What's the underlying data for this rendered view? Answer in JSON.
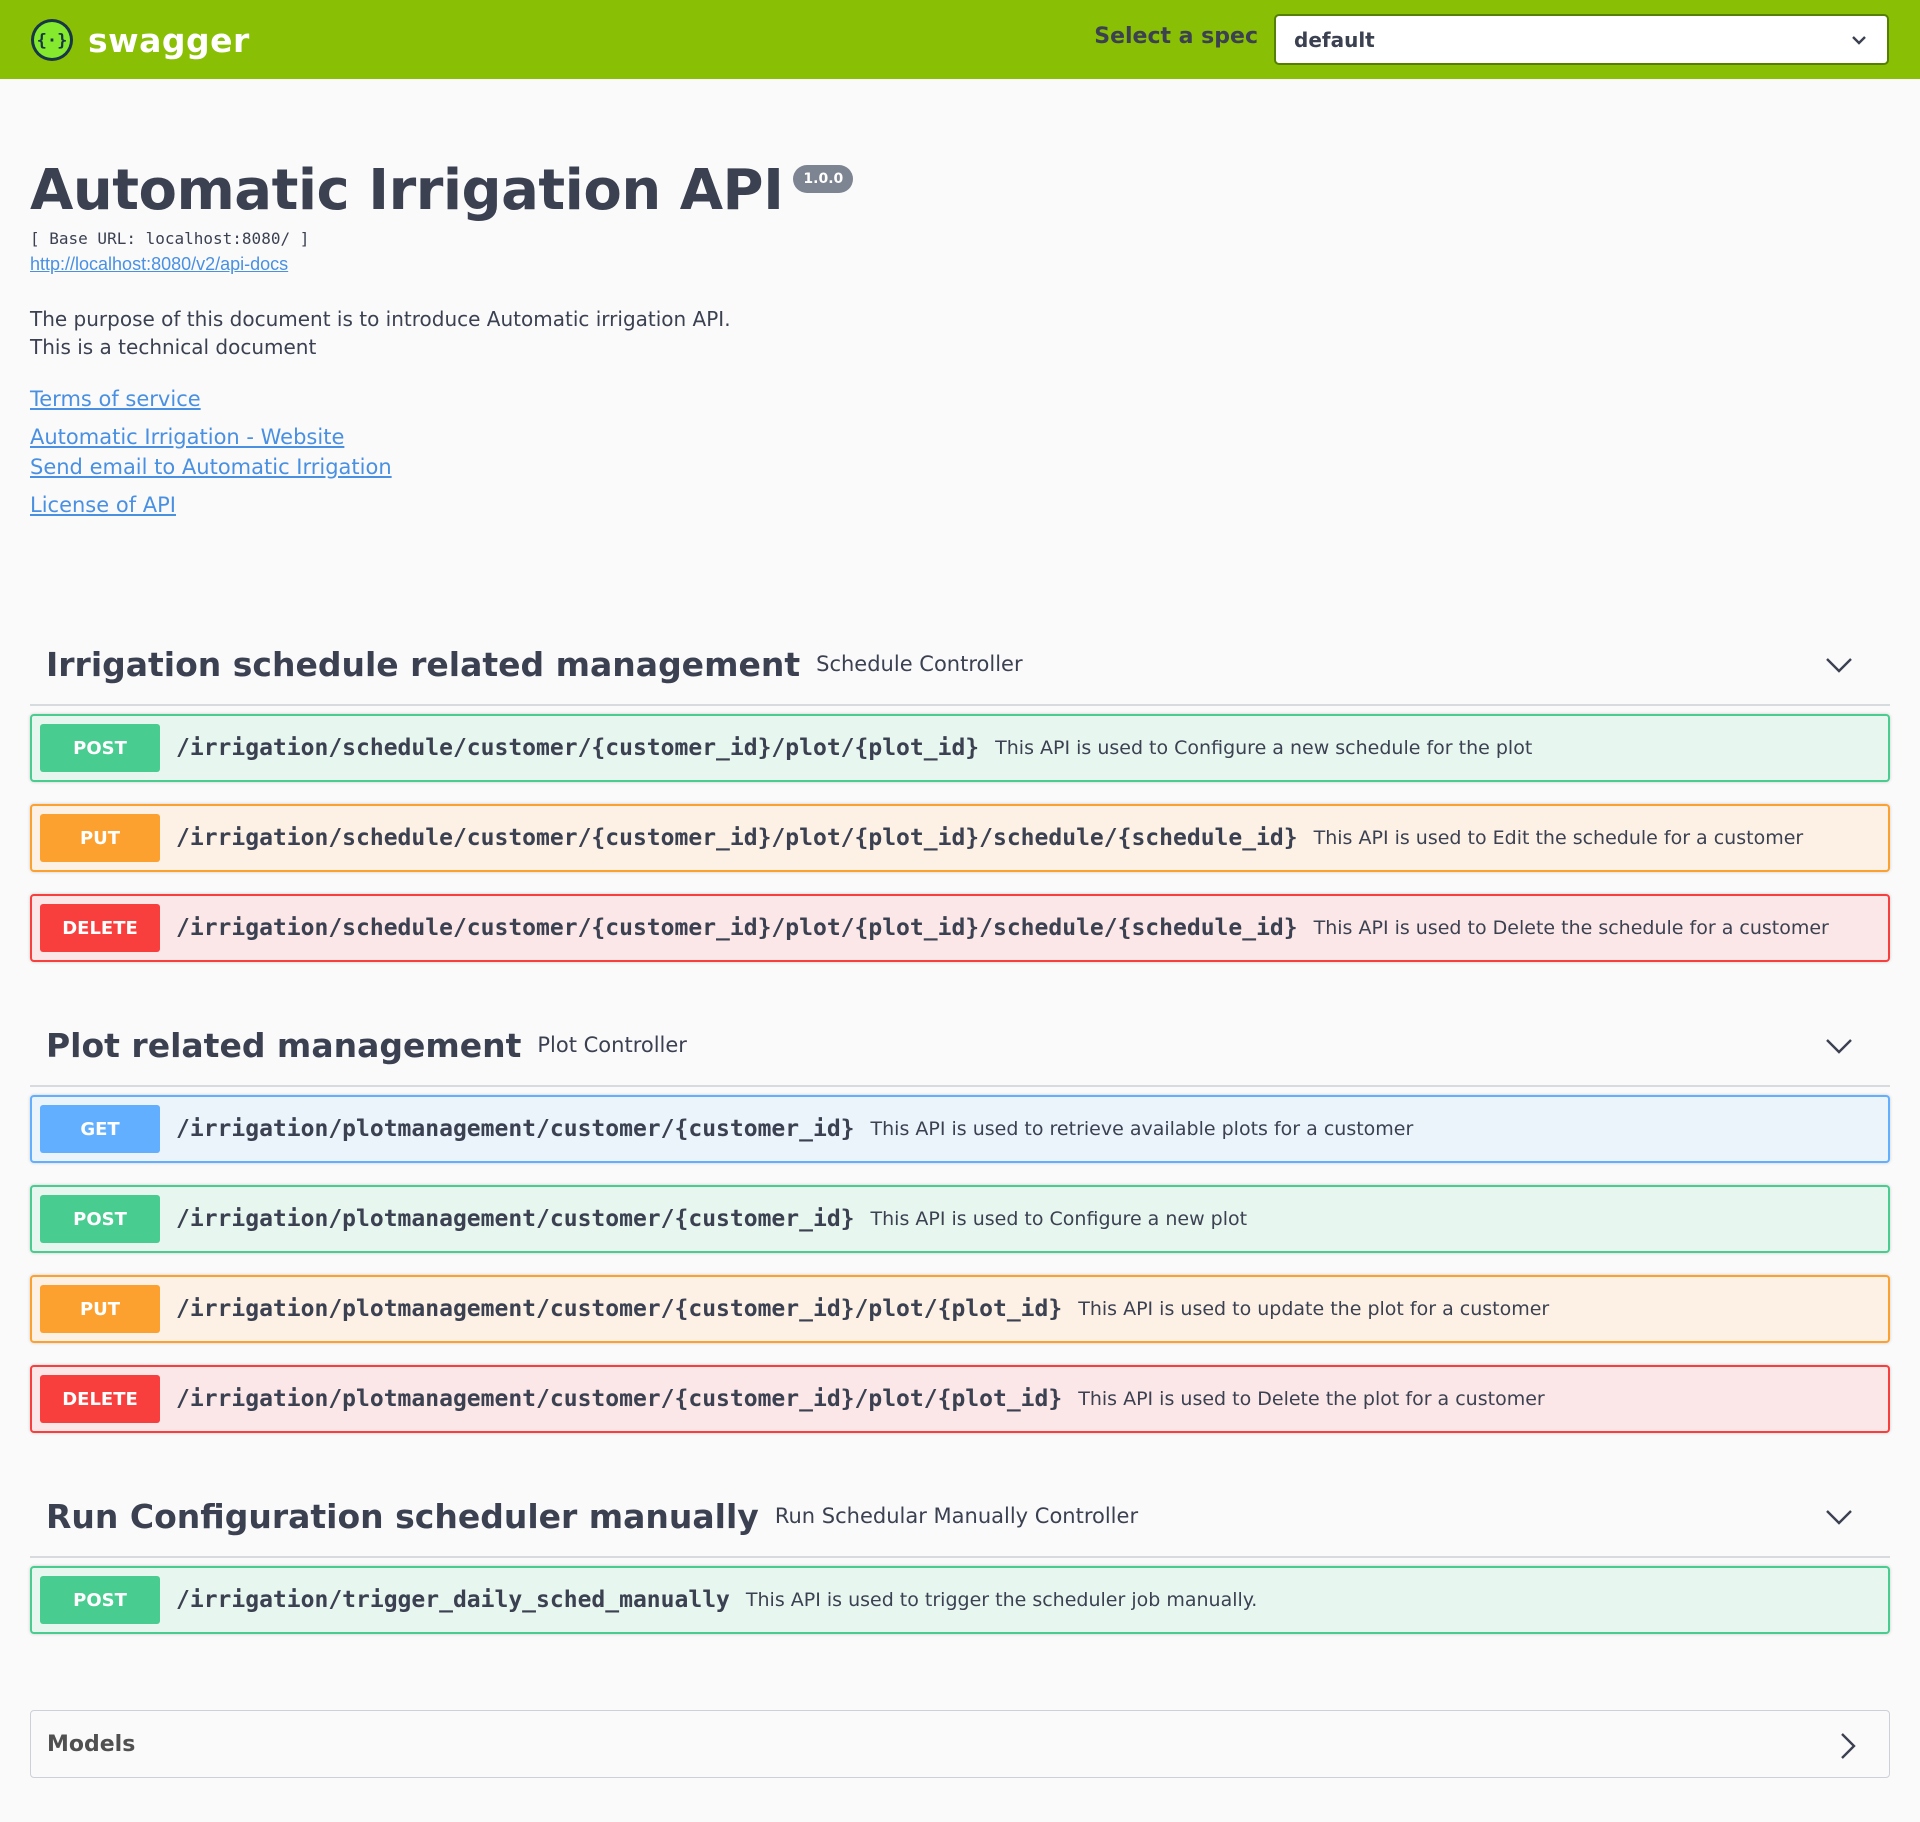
{
  "topbar": {
    "brand": "swagger",
    "spec_label": "Select a spec",
    "spec_value": "default"
  },
  "info": {
    "title": "Automatic Irrigation API",
    "version": "1.0.0",
    "base_url": "[ Base URL: localhost:8080/ ]",
    "docs_link": "http://localhost:8080/v2/api-docs",
    "description_line1": "The purpose of this document is to introduce Automatic irrigation API.",
    "description_line2": "This is a technical document",
    "terms": "Terms of service",
    "website": "Automatic Irrigation - Website",
    "email": "Send email to Automatic Irrigation",
    "license": "License of API"
  },
  "tags": [
    {
      "title": "Irrigation schedule related management",
      "description": "Schedule Controller",
      "operations": [
        {
          "method": "POST",
          "path": "/irrigation/schedule/customer/{customer_id}/plot/{plot_id}",
          "summary": "This API is used to Configure a new schedule for the plot"
        },
        {
          "method": "PUT",
          "path": "/irrigation/schedule/customer/{customer_id}/plot/{plot_id}/schedule/{schedule_id}",
          "summary": "This API is used to Edit the schedule for a customer"
        },
        {
          "method": "DELETE",
          "path": "/irrigation/schedule/customer/{customer_id}/plot/{plot_id}/schedule/{schedule_id}",
          "summary": "This API is used to Delete the schedule for a customer"
        }
      ]
    },
    {
      "title": "Plot related management",
      "description": "Plot Controller",
      "operations": [
        {
          "method": "GET",
          "path": "/irrigation/plotmanagement/customer/{customer_id}",
          "summary": "This API is used to retrieve available plots for a customer"
        },
        {
          "method": "POST",
          "path": "/irrigation/plotmanagement/customer/{customer_id}",
          "summary": "This API is used to Configure a new plot"
        },
        {
          "method": "PUT",
          "path": "/irrigation/plotmanagement/customer/{customer_id}/plot/{plot_id}",
          "summary": "This API is used to update the plot for a customer"
        },
        {
          "method": "DELETE",
          "path": "/irrigation/plotmanagement/customer/{customer_id}/plot/{plot_id}",
          "summary": "This API is used to Delete the plot for a customer"
        }
      ]
    },
    {
      "title": "Run Configuration scheduler manually",
      "description": "Run Schedular Manually Controller",
      "operations": [
        {
          "method": "POST",
          "path": "/irrigation/trigger_daily_sched_manually",
          "summary": "This API is used to trigger the scheduler job manually."
        }
      ]
    }
  ],
  "models": {
    "title": "Models"
  },
  "colors": {
    "topbar": "#89bf04",
    "post": "#49cc90",
    "put": "#fca130",
    "delete": "#f93e3e",
    "get": "#61affe",
    "link": "#4990e2"
  },
  "icons": {
    "logo": "swagger-logo-icon",
    "select_chevron": "chevron-down-icon",
    "tag_chevron": "chevron-down-icon",
    "models_chevron": "chevron-right-icon"
  }
}
